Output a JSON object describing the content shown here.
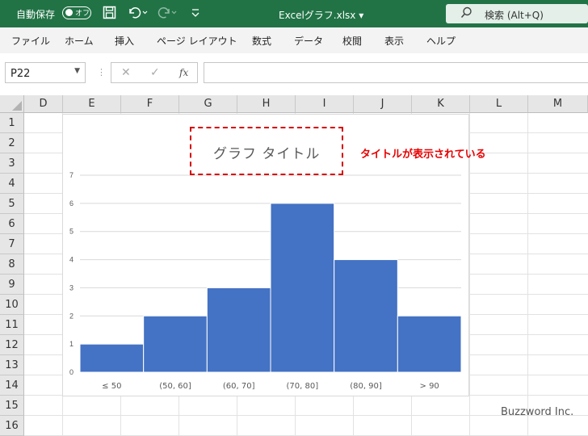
{
  "titlebar": {
    "autosave_label": "自動保存",
    "autosave_state": "オフ",
    "filename": "Excelグラフ.xlsx",
    "search_label": "検索 (Alt+Q)"
  },
  "menu": [
    "ファイル",
    "ホーム",
    "挿入",
    "ページ レイアウト",
    "数式",
    "データ",
    "校閲",
    "表示",
    "ヘルプ"
  ],
  "formula_bar": {
    "name_box": "P22",
    "cancel_symbol": "✕",
    "enter_symbol": "✓",
    "fx_label": "fx",
    "value": ""
  },
  "grid": {
    "columns": [
      "D",
      "E",
      "F",
      "G",
      "H",
      "I",
      "J",
      "K",
      "L",
      "M"
    ],
    "rows": [
      "1",
      "2",
      "3",
      "4",
      "5",
      "6",
      "7",
      "8",
      "9",
      "10",
      "11",
      "12",
      "13",
      "14",
      "15",
      "16"
    ]
  },
  "chart_data": {
    "type": "bar",
    "title": "グラフ タイトル",
    "categories": [
      "≤ 50",
      "(50, 60]",
      "(60, 70]",
      "(70, 80]",
      "(80, 90]",
      "> 90"
    ],
    "values": [
      1,
      2,
      3,
      6,
      4,
      2
    ],
    "yticks": [
      "0",
      "1",
      "2",
      "3",
      "4",
      "5",
      "6",
      "7"
    ],
    "ylim": [
      0,
      7
    ],
    "grid": true,
    "bar_color": "#4472C4"
  },
  "annotation": {
    "callout_text": "タイトルが表示されている",
    "color": "#E60000"
  },
  "watermark": "Buzzword Inc.",
  "colors": {
    "titlebar": "#217346"
  }
}
